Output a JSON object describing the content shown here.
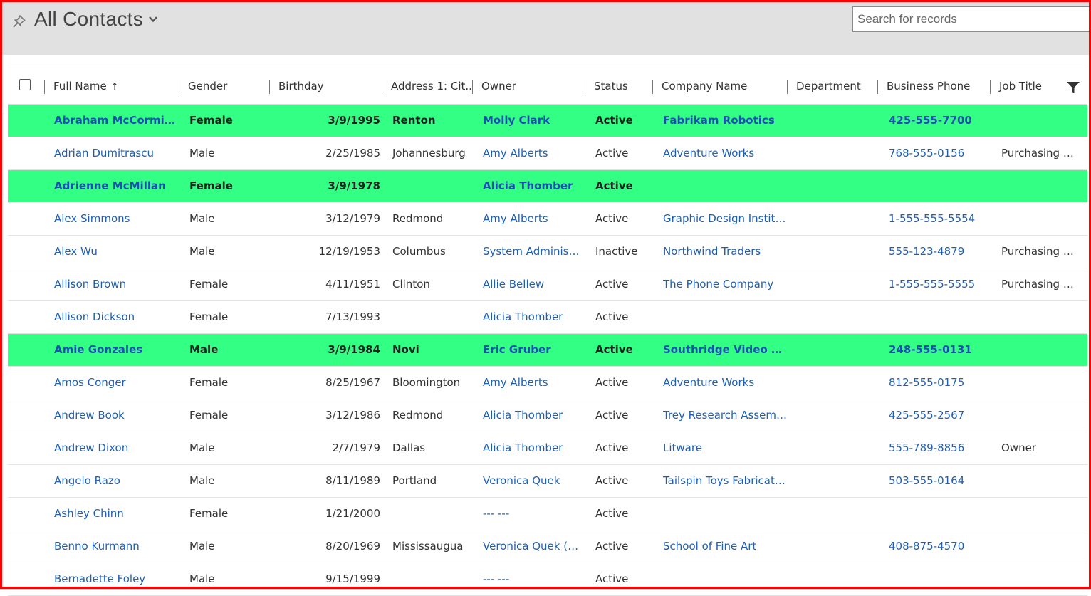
{
  "view": {
    "title": "All Contacts"
  },
  "search": {
    "placeholder": "Search for records"
  },
  "columns": {
    "full_name": "Full Name",
    "gender": "Gender",
    "birthday": "Birthday",
    "city": "Address 1: Cit...",
    "owner": "Owner",
    "status": "Status",
    "company": "Company Name",
    "department": "Department",
    "phone": "Business Phone",
    "job": "Job Title"
  },
  "sort": {
    "column": "Full Name",
    "direction": "ascending"
  },
  "highlight_color": "#33ff84",
  "link_color": "#1f5fb0",
  "rows": [
    {
      "name": "Abraham McCormick",
      "gender": "Female",
      "birthday": "3/9/1995",
      "city": "Renton",
      "owner": "Molly Clark",
      "status": "Active",
      "company": "Fabrikam Robotics",
      "department": "",
      "phone": "425-555-7700",
      "job": "",
      "highlighted": true
    },
    {
      "name": "Adrian Dumitrascu",
      "gender": "Male",
      "birthday": "2/25/1985",
      "city": "Johannesburg",
      "owner": "Amy Alberts",
      "status": "Active",
      "company": "Adventure Works",
      "department": "",
      "phone": "768-555-0156",
      "job": "Purchasing M...",
      "highlighted": false
    },
    {
      "name": "Adrienne McMillan",
      "gender": "Female",
      "birthday": "3/9/1978",
      "city": "",
      "owner": "Alicia Thomber",
      "status": "Active",
      "company": "",
      "department": "",
      "phone": "",
      "job": "",
      "highlighted": true
    },
    {
      "name": "Alex Simmons",
      "gender": "Male",
      "birthday": "3/12/1979",
      "city": "Redmond",
      "owner": "Amy Alberts",
      "status": "Active",
      "company": "Graphic Design Institute",
      "department": "",
      "phone": "1-555-555-5554",
      "job": "",
      "highlighted": false
    },
    {
      "name": "Alex Wu",
      "gender": "Male",
      "birthday": "12/19/1953",
      "city": "Columbus",
      "owner": "System Administr...",
      "status": "Inactive",
      "company": "Northwind Traders",
      "department": "",
      "phone": "555-123-4879",
      "job": "Purchasing M...",
      "highlighted": false
    },
    {
      "name": "Allison Brown",
      "gender": "Female",
      "birthday": "4/11/1951",
      "city": "Clinton",
      "owner": "Allie Bellew",
      "status": "Active",
      "company": "The Phone Company",
      "department": "",
      "phone": "1-555-555-5555",
      "job": "Purchasing M...",
      "highlighted": false
    },
    {
      "name": "Allison Dickson",
      "gender": "Female",
      "birthday": "7/13/1993",
      "city": "",
      "owner": "Alicia Thomber",
      "status": "Active",
      "company": "",
      "department": "",
      "phone": "",
      "job": "",
      "highlighted": false
    },
    {
      "name": "Amie Gonzales",
      "gender": "Male",
      "birthday": "3/9/1984",
      "city": "Novi",
      "owner": "Eric Gruber",
      "status": "Active",
      "company": "Southridge Video Ele...",
      "department": "",
      "phone": "248-555-0131",
      "job": "",
      "highlighted": true
    },
    {
      "name": "Amos Conger",
      "gender": "Female",
      "birthday": "8/25/1967",
      "city": "Bloomington",
      "owner": "Amy Alberts",
      "status": "Active",
      "company": "Adventure Works",
      "department": "",
      "phone": "812-555-0175",
      "job": "",
      "highlighted": false
    },
    {
      "name": "Andrew Book",
      "gender": "Female",
      "birthday": "3/12/1986",
      "city": "Redmond",
      "owner": "Alicia Thomber",
      "status": "Active",
      "company": "Trey Research Assembly",
      "department": "",
      "phone": "425-555-2567",
      "job": "",
      "highlighted": false
    },
    {
      "name": "Andrew Dixon",
      "gender": "Male",
      "birthday": "2/7/1979",
      "city": "Dallas",
      "owner": "Alicia Thomber",
      "status": "Active",
      "company": "Litware",
      "department": "",
      "phone": "555-789-8856",
      "job": "Owner",
      "highlighted": false
    },
    {
      "name": "Angelo Razo",
      "gender": "Male",
      "birthday": "8/11/1989",
      "city": "Portland",
      "owner": "Veronica Quek",
      "status": "Active",
      "company": "Tailspin Toys Fabrication",
      "department": "",
      "phone": "503-555-0164",
      "job": "",
      "highlighted": false
    },
    {
      "name": "Ashley Chinn",
      "gender": "Female",
      "birthday": "1/21/2000",
      "city": "",
      "owner": "--- ---",
      "status": "Active",
      "company": "",
      "department": "",
      "phone": "",
      "job": "",
      "highlighted": false
    },
    {
      "name": "Benno Kurmann",
      "gender": "Male",
      "birthday": "8/20/1969",
      "city": "Mississaugua",
      "owner": "Veronica Quek (S...",
      "status": "Active",
      "company": "School of Fine Art",
      "department": "",
      "phone": "408-875-4570",
      "job": "",
      "highlighted": false
    },
    {
      "name": "Bernadette Foley",
      "gender": "Male",
      "birthday": "9/15/1999",
      "city": "",
      "owner": "--- ---",
      "status": "Active",
      "company": "",
      "department": "",
      "phone": "",
      "job": "",
      "highlighted": false
    }
  ]
}
